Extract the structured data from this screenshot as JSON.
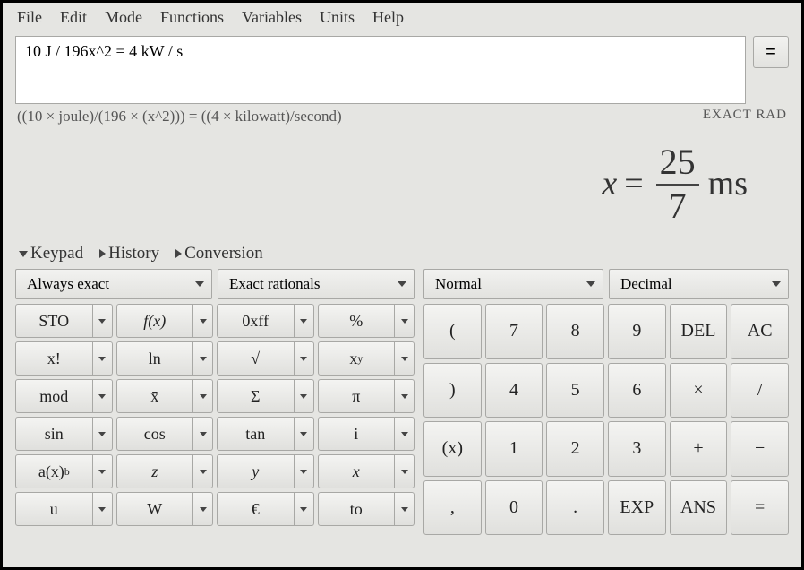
{
  "menu": [
    "File",
    "Edit",
    "Mode",
    "Functions",
    "Variables",
    "Units",
    "Help"
  ],
  "input": "10 J / 196x^2 = 4 kW / s",
  "equals_btn": "=",
  "parsed": "((10 × joule)/(196 × (x^2))) = ((4 × kilowatt)/second)",
  "status": "EXACT RAD",
  "result": {
    "lhs": "x",
    "eq": "=",
    "num": "25",
    "den": "7",
    "unit": "ms"
  },
  "tabs": [
    "Keypad",
    "History",
    "Conversion"
  ],
  "left_combos": [
    "Always exact",
    "Exact rationals"
  ],
  "right_combos": [
    "Normal",
    "Decimal"
  ],
  "left_buttons": [
    [
      {
        "l": "STO",
        "dd": true
      },
      {
        "l": "f(x)",
        "it": true,
        "dd": true
      },
      {
        "l": "0xff",
        "dd": true
      },
      {
        "l": "%",
        "dd": true
      }
    ],
    [
      {
        "l": "x!",
        "dd": true
      },
      {
        "l": "ln",
        "dd": true
      },
      {
        "l": "√",
        "dd": true
      },
      {
        "html": "x<span class=\"sup\">y</span>",
        "dd": true
      }
    ],
    [
      {
        "l": "mod",
        "dd": true
      },
      {
        "l": "x̄",
        "dd": true
      },
      {
        "l": "Σ",
        "dd": true
      },
      {
        "l": "π",
        "dd": true
      }
    ],
    [
      {
        "l": "sin",
        "dd": true
      },
      {
        "l": "cos",
        "dd": true
      },
      {
        "l": "tan",
        "dd": true
      },
      {
        "l": "i",
        "dd": true
      }
    ],
    [
      {
        "html": "a(x)<span class=\"sup\">b</span>",
        "dd": true
      },
      {
        "l": "z",
        "it": true,
        "dd": true
      },
      {
        "l": "y",
        "it": true,
        "dd": true
      },
      {
        "l": "x",
        "it": true,
        "dd": true
      }
    ],
    [
      {
        "l": "u",
        "dd": true
      },
      {
        "l": "W",
        "dd": true
      },
      {
        "l": "€",
        "dd": true
      },
      {
        "l": "to",
        "dd": true
      }
    ]
  ],
  "right_buttons": [
    [
      "(",
      "7",
      "8",
      "9",
      "DEL",
      "AC"
    ],
    [
      ")",
      "4",
      "5",
      "6",
      "×",
      "/"
    ],
    [
      "(x)",
      "1",
      "2",
      "3",
      "+",
      "−"
    ],
    [
      ",",
      "0",
      ".",
      "EXP",
      "ANS",
      "="
    ]
  ]
}
